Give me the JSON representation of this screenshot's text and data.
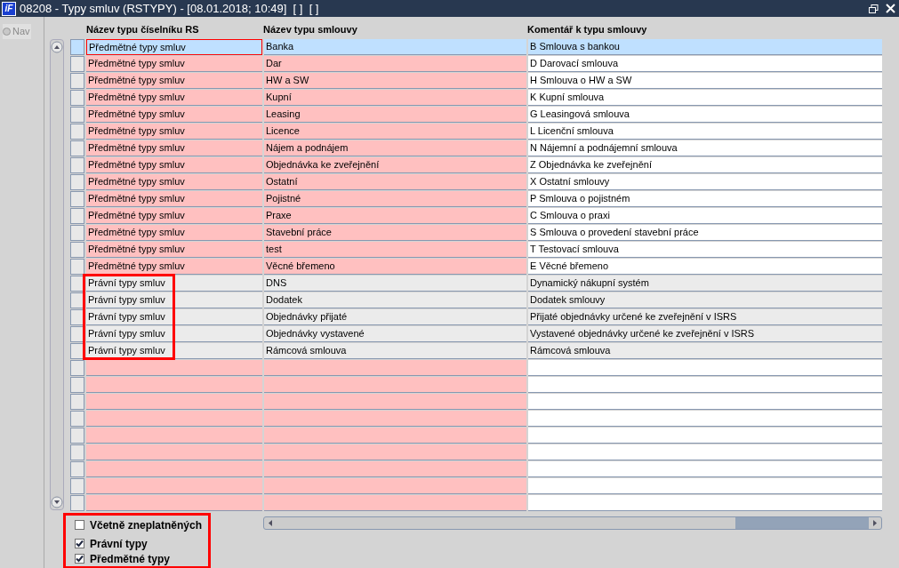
{
  "window": {
    "logo": "iF",
    "title": "08208 - Typy smluv (RSTYPY) - [08.01.2018; 10:49]  [ ]  [ ]"
  },
  "nav": {
    "label": "Nav",
    "selected": false
  },
  "table": {
    "columns": [
      "Název typu číselníku RS",
      "Název typu smlouvy",
      "Komentář k typu smlouvy"
    ],
    "rows": [
      {
        "kind": "subject",
        "selected": true,
        "cells": [
          "Předmětné typy smluv",
          "Banka",
          "B Smlouva s bankou"
        ]
      },
      {
        "kind": "subject",
        "selected": false,
        "cells": [
          "Předmětné typy smluv",
          "Dar",
          "D Darovací smlouva"
        ]
      },
      {
        "kind": "subject",
        "selected": false,
        "cells": [
          "Předmětné typy smluv",
          "HW a SW",
          "H Smlouva o HW a SW"
        ]
      },
      {
        "kind": "subject",
        "selected": false,
        "cells": [
          "Předmětné typy smluv",
          "Kupní",
          "K Kupní smlouva"
        ]
      },
      {
        "kind": "subject",
        "selected": false,
        "cells": [
          "Předmětné typy smluv",
          "Leasing",
          "G Leasingová smlouva"
        ]
      },
      {
        "kind": "subject",
        "selected": false,
        "cells": [
          "Předmětné typy smluv",
          "Licence",
          "L Licenční smlouva"
        ]
      },
      {
        "kind": "subject",
        "selected": false,
        "cells": [
          "Předmětné typy smluv",
          "Nájem a podnájem",
          "N Nájemní a podnájemní smlouva"
        ]
      },
      {
        "kind": "subject",
        "selected": false,
        "cells": [
          "Předmětné typy smluv",
          "Objednávka ke zveřejnění",
          "Z Objednávka ke zveřejnění"
        ]
      },
      {
        "kind": "subject",
        "selected": false,
        "cells": [
          "Předmětné typy smluv",
          "Ostatní",
          "X Ostatní smlouvy"
        ]
      },
      {
        "kind": "subject",
        "selected": false,
        "cells": [
          "Předmětné typy smluv",
          "Pojistné",
          "P Smlouva o pojistném"
        ]
      },
      {
        "kind": "subject",
        "selected": false,
        "cells": [
          "Předmětné typy smluv",
          "Praxe",
          "C Smlouva o praxi"
        ]
      },
      {
        "kind": "subject",
        "selected": false,
        "cells": [
          "Předmětné typy smluv",
          "Stavební práce",
          "S Smlouva o provedení stavební práce"
        ]
      },
      {
        "kind": "subject",
        "selected": false,
        "cells": [
          "Předmětné typy smluv",
          "test",
          "T Testovací smlouva"
        ]
      },
      {
        "kind": "subject",
        "selected": false,
        "cells": [
          "Předmětné typy smluv",
          "Věcné břemeno",
          "E Věcné břemeno"
        ]
      },
      {
        "kind": "legal",
        "selected": false,
        "cells": [
          "Právní typy smluv",
          "DNS",
          "Dynamický nákupní systém"
        ]
      },
      {
        "kind": "legal",
        "selected": false,
        "cells": [
          "Právní typy smluv",
          "Dodatek",
          "Dodatek smlouvy"
        ]
      },
      {
        "kind": "legal",
        "selected": false,
        "cells": [
          "Právní typy smluv",
          "Objednávky přijaté",
          "Přijaté objednávky určené ke zveřejnění v ISRS"
        ]
      },
      {
        "kind": "legal",
        "selected": false,
        "cells": [
          "Právní typy smluv",
          "Objednávky vystavené",
          "Vystavené objednávky určené ke zveřejnění v ISRS"
        ]
      },
      {
        "kind": "legal",
        "selected": false,
        "cells": [
          "Právní typy smluv",
          "Rámcová smlouva",
          "Rámcová smlouva"
        ]
      }
    ]
  },
  "filters": [
    {
      "label": "Včetně zneplatněných",
      "checked": false
    },
    {
      "label": "Právní typy",
      "checked": true
    },
    {
      "label": "Předmětné typy",
      "checked": true
    }
  ]
}
